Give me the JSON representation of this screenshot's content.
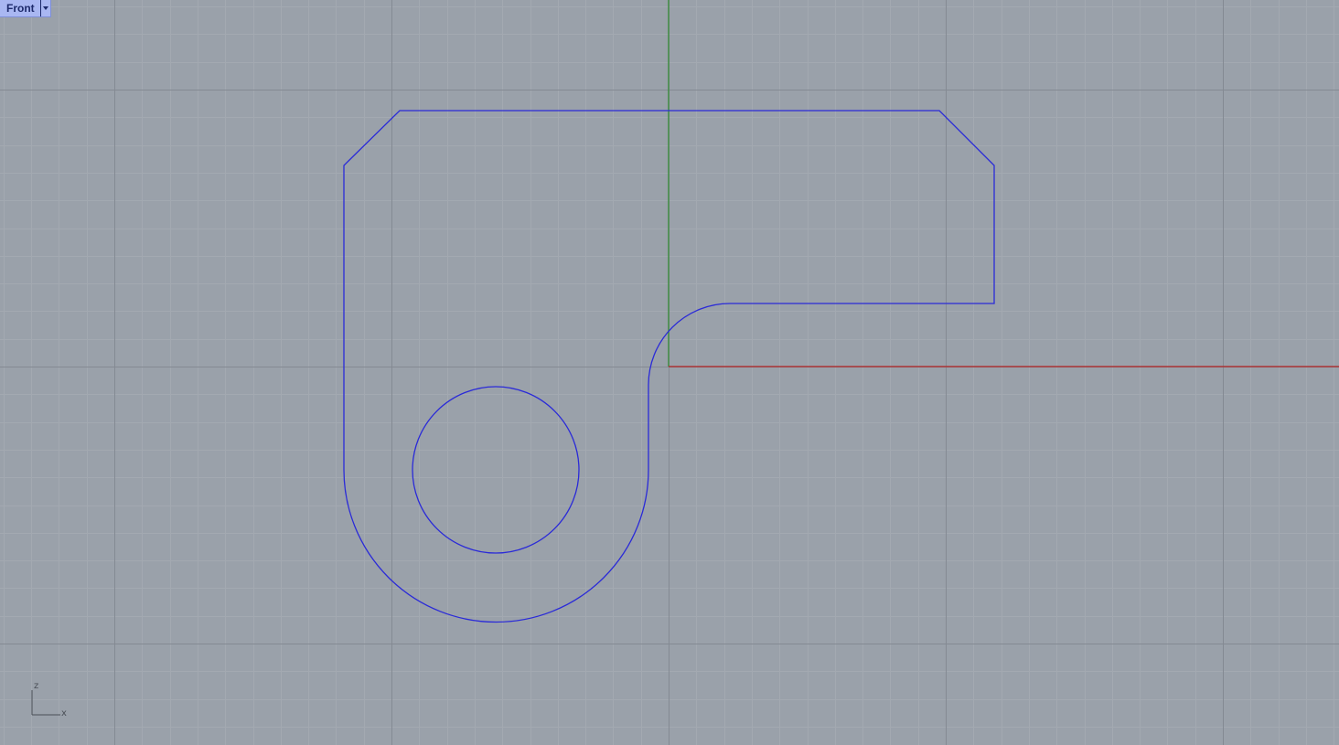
{
  "viewport": {
    "name": "Front"
  },
  "axis_icon": {
    "vertical_label": "z",
    "horizontal_label": "x"
  },
  "colors": {
    "background": "#9aa1aa",
    "minor_grid": "#a3a9b1",
    "major_grid": "#848a93",
    "x_axis": "#b22222",
    "vertical_axis": "#2e8b2e",
    "curve": "#2a2ad8"
  }
}
